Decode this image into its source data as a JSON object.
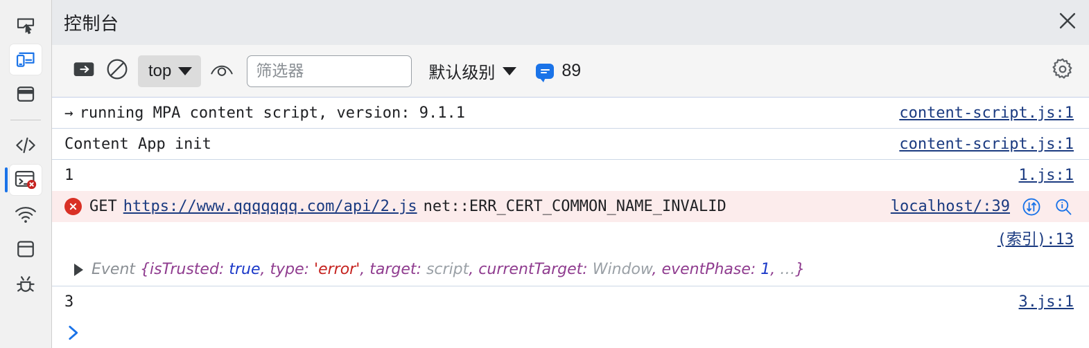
{
  "window": {
    "title": "控制台",
    "close_label": "×"
  },
  "activity_bar": {
    "items": [
      {
        "name": "inspect-element",
        "icon": "inspect-icon",
        "active": false
      },
      {
        "name": "device-toolbar",
        "icon": "device-toolbar-icon",
        "active": true
      },
      {
        "name": "panel-layout",
        "icon": "panel-icon",
        "active": false
      },
      {
        "name": "sources",
        "icon": "code-brackets-icon",
        "active": false
      },
      {
        "name": "console",
        "icon": "console-error-icon",
        "active": true
      },
      {
        "name": "network",
        "icon": "wifi-icon",
        "active": false
      },
      {
        "name": "storage",
        "icon": "database-icon",
        "active": false
      },
      {
        "name": "issues",
        "icon": "bug-icon",
        "active": false
      }
    ]
  },
  "toolbar": {
    "sidebar_toggle_label": "sidebar-toggle",
    "clear_console_label": "clear-console",
    "context": {
      "value": "top"
    },
    "eye_label": "live-expression",
    "filter": {
      "value": "",
      "placeholder": "筛选器"
    },
    "levels": {
      "value": "默认级别"
    },
    "message_count": "89",
    "settings_label": "settings"
  },
  "console": {
    "messages": [
      {
        "kind": "log",
        "prefix": "→",
        "text": "running MPA content script, version: 9.1.1",
        "source": "content-script.js:1"
      },
      {
        "kind": "log",
        "prefix": "",
        "text": "Content App init",
        "source": "content-script.js:1"
      },
      {
        "kind": "log",
        "prefix": "",
        "text": "1",
        "source": "1.js:1"
      },
      {
        "kind": "error",
        "method": "GET",
        "url": "https://www.qqqqqqq.com/api/2.js",
        "error_code": "net::ERR_CERT_COMMON_NAME_INVALID",
        "source": "localhost/:39",
        "network_icon": "network-request-icon",
        "search_icon": "search-in-page-icon"
      },
      {
        "kind": "object",
        "source": "(索引):13",
        "class_name": "Event",
        "open_brace": "{",
        "properties": [
          {
            "key": "isTrusted",
            "value": "true",
            "type": "bool"
          },
          {
            "key": "type",
            "value": "'error'",
            "type": "string"
          },
          {
            "key": "target",
            "value": "script",
            "type": "object"
          },
          {
            "key": "currentTarget",
            "value": "Window",
            "type": "object"
          },
          {
            "key": "eventPhase",
            "value": "1",
            "type": "number"
          }
        ],
        "ellipsis": "…",
        "close_brace": "}"
      },
      {
        "kind": "log",
        "prefix": "",
        "text": "3",
        "source": "3.js:1"
      }
    ],
    "prompt_caret": "❯"
  },
  "colors": {
    "accent": "#1a73e8",
    "error": "#d93025",
    "error_bg": "#fcecec",
    "link": "#1a3a80",
    "divider": "#ccd7e6",
    "titlebar_bg": "#e8eaed",
    "toolbar_bg": "#f5f5f5",
    "rail_bg": "#f1f1f1"
  }
}
